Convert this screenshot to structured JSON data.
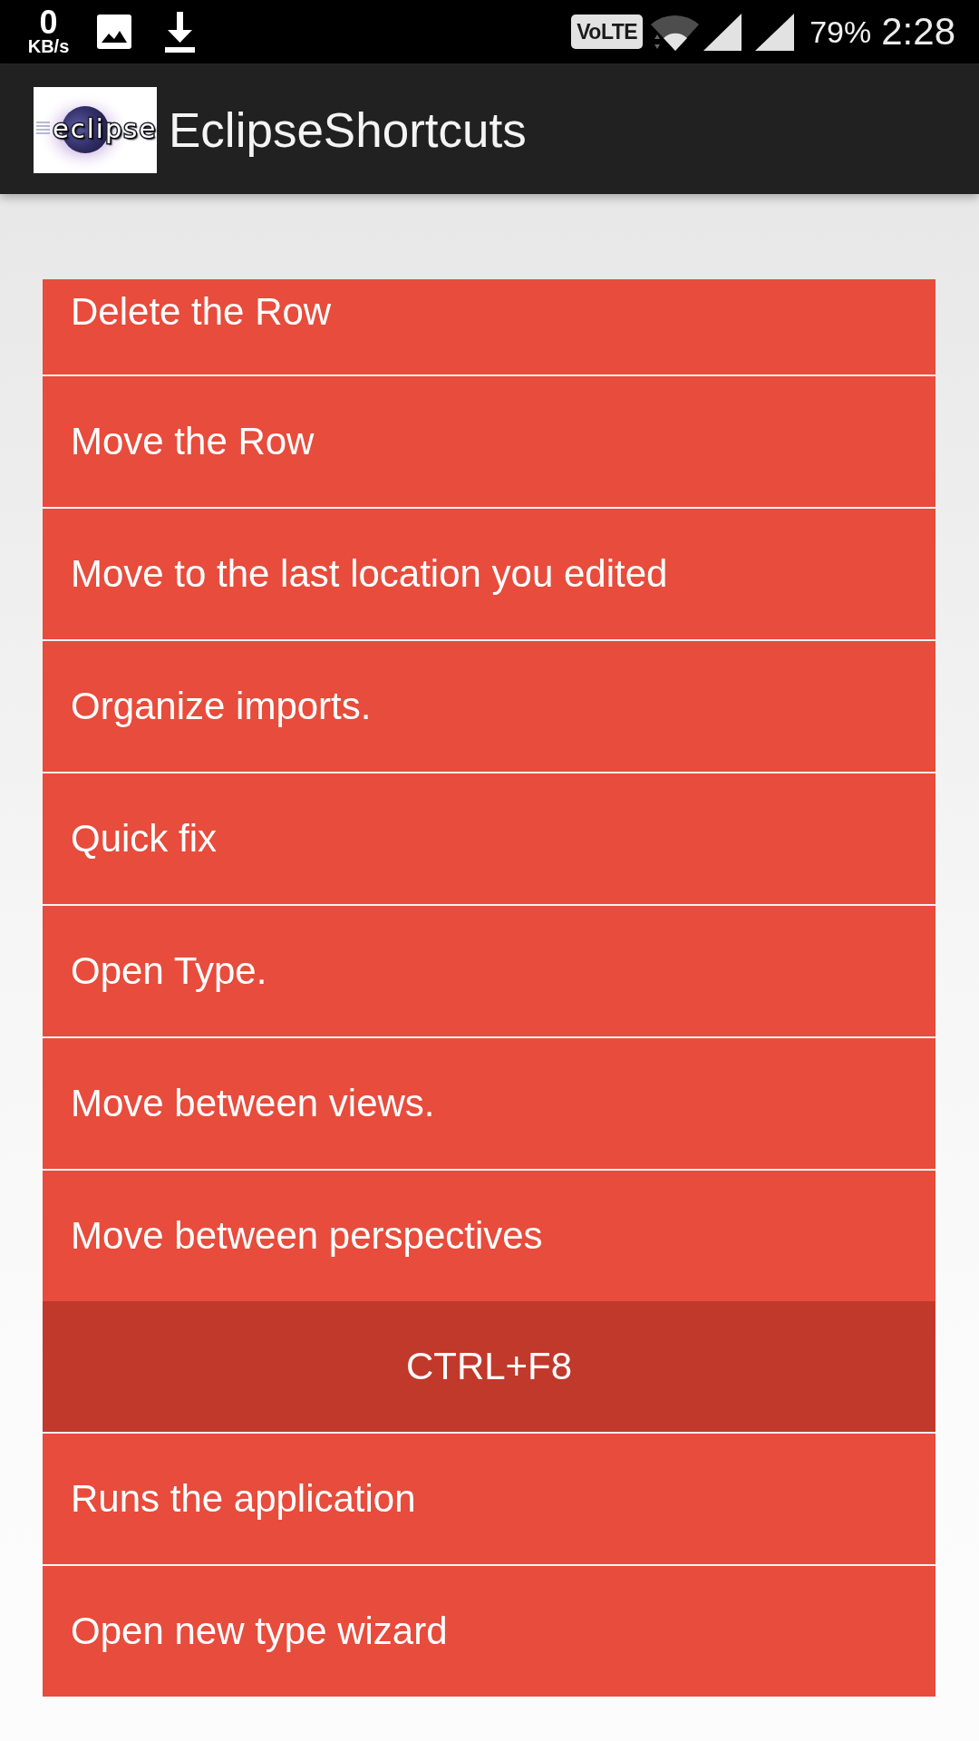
{
  "status_bar": {
    "speed_value": "0",
    "speed_unit": "KB/s",
    "volte": "VoLTE",
    "battery": "79%",
    "time": "2:28"
  },
  "app_bar": {
    "logo_text": "eclipse",
    "title": "EclipseShortcuts"
  },
  "shortcuts": [
    {
      "label": "Delete the Row"
    },
    {
      "label": "Move the Row"
    },
    {
      "label": "Move to the last location you edited"
    },
    {
      "label": "Organize imports."
    },
    {
      "label": "Quick fix"
    },
    {
      "label": "Open Type."
    },
    {
      "label": "Move between views."
    },
    {
      "label": "Move between perspectives",
      "shortcut": "CTRL+F8"
    },
    {
      "label": "Runs the application"
    },
    {
      "label": "Open new type wizard"
    }
  ]
}
